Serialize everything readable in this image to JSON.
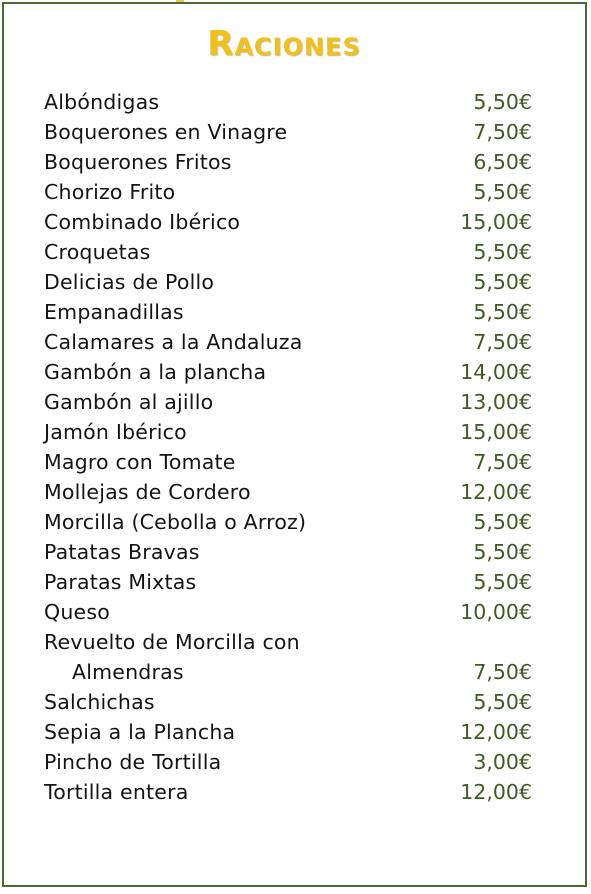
{
  "title": "Raciones",
  "colors": {
    "title": "#f2c018",
    "price": "#3f5a23",
    "text": "#141414",
    "border": "#4a6a32"
  },
  "items": [
    {
      "name": "Albóndigas",
      "price": "5,50€"
    },
    {
      "name": "Boquerones en Vinagre",
      "price": "7,50€"
    },
    {
      "name": "Boquerones Fritos",
      "price": "6,50€"
    },
    {
      "name": "Chorizo Frito",
      "price": "5,50€"
    },
    {
      "name": "Combinado Ibérico",
      "price": "15,00€"
    },
    {
      "name": "Croquetas",
      "price": "5,50€"
    },
    {
      "name": "Delicias de Pollo",
      "price": "5,50€"
    },
    {
      "name": "Empanadillas",
      "price": "5,50€"
    },
    {
      "name": "Calamares a la Andaluza",
      "price": "7,50€"
    },
    {
      "name": "Gambón a la plancha",
      "price": "14,00€"
    },
    {
      "name": "Gambón al ajillo",
      "price": "13,00€"
    },
    {
      "name": "Jamón Ibérico",
      "price": "15,00€"
    },
    {
      "name": "Magro con Tomate",
      "price": "7,50€"
    },
    {
      "name": "Mollejas de Cordero",
      "price": "12,00€"
    },
    {
      "name": "Morcilla (Cebolla o Arroz)",
      "price": "5,50€"
    },
    {
      "name": "Patatas Bravas",
      "price": "5,50€"
    },
    {
      "name": "Paratas Mixtas",
      "price": "5,50€"
    },
    {
      "name": "Queso",
      "price": "10,00€"
    },
    {
      "name": "Revuelto de Morcilla con",
      "name_cont": "Almendras",
      "price": "7,50€"
    },
    {
      "name": "Salchichas",
      "price": "5,50€"
    },
    {
      "name": "Sepia a la Plancha",
      "price": "12,00€"
    },
    {
      "name": "Pincho de Tortilla",
      "price": "3,00€"
    },
    {
      "name": "Tortilla entera",
      "price": "12,00€"
    }
  ]
}
